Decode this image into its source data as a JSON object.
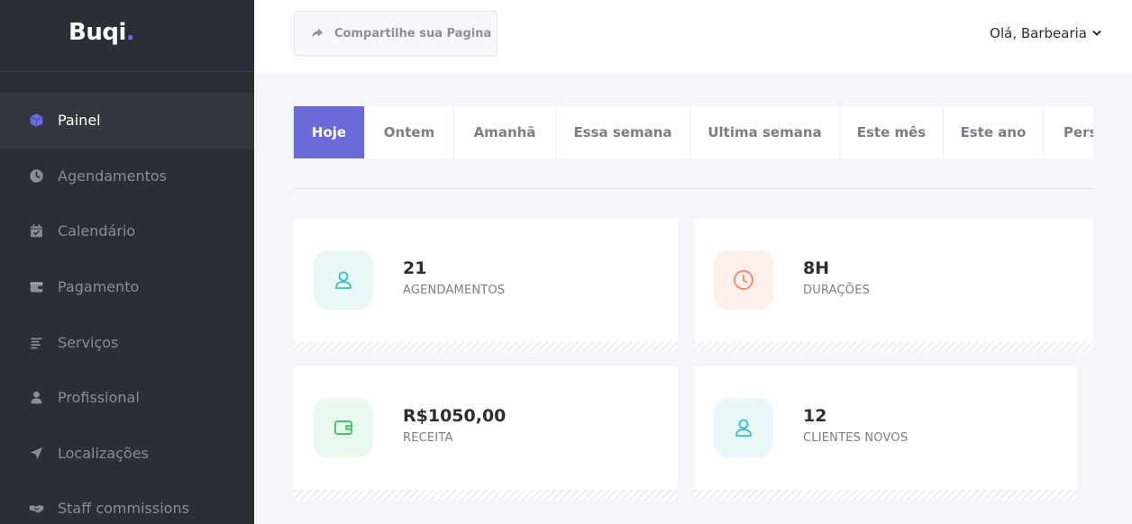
{
  "brand": {
    "name": "Buqi",
    "dot": "."
  },
  "sidebar": {
    "items": [
      {
        "label": "Painel",
        "icon": "cube-icon",
        "active": true
      },
      {
        "label": "Agendamentos",
        "icon": "clock-icon"
      },
      {
        "label": "Calendário",
        "icon": "calendar-check-icon"
      },
      {
        "label": "Pagamento",
        "icon": "wallet-icon"
      },
      {
        "label": "Serviços",
        "icon": "list-icon"
      },
      {
        "label": "Profissional",
        "icon": "user-icon"
      },
      {
        "label": "Localizações",
        "icon": "location-arrow-icon"
      },
      {
        "label": "Staff commissions",
        "icon": "handshake-icon"
      }
    ]
  },
  "header": {
    "share_label": "Compartilhe sua Pagina",
    "user_label": "Olá, Barbearia"
  },
  "tabs": [
    {
      "label": "Hoje",
      "active": true
    },
    {
      "label": "Ontem"
    },
    {
      "label": "Amanhã"
    },
    {
      "label": "Essa semana"
    },
    {
      "label": "Ultima semana"
    },
    {
      "label": "Este mês"
    },
    {
      "label": "Este ano"
    },
    {
      "label": "Pers"
    }
  ],
  "stats": [
    {
      "value": "21",
      "label": "AGENDAMENTOS",
      "icon": "user-icon",
      "color": "#2ec4c4",
      "bg": "#e8f8f9"
    },
    {
      "value": "8H",
      "label": "DURAÇÕES",
      "icon": "clock-icon",
      "color": "#f08a6a",
      "bg": "#fdf0ec"
    },
    {
      "value": "R$1050,00",
      "label": "RECEITA",
      "icon": "wallet-icon",
      "color": "#3fc86a",
      "bg": "#eaf9ee"
    },
    {
      "value": "12",
      "label": "CLIENTES NOVOS",
      "icon": "user-icon",
      "color": "#2ec4c4",
      "bg": "#e8f8f9"
    }
  ],
  "colors": {
    "sidebar_bg": "#2b2e35",
    "accent": "#6a6ad8",
    "page_bg": "#f5f6fa"
  }
}
